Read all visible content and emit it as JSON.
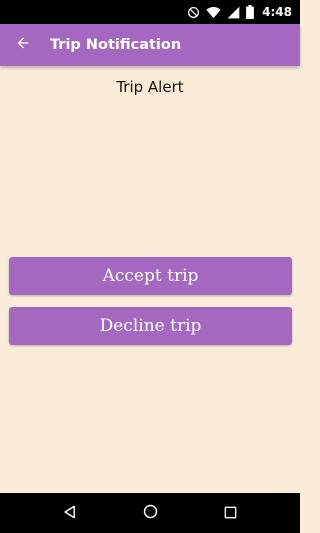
{
  "status_bar": {
    "time": "4:48",
    "icons": [
      "do-not-disturb-icon",
      "wifi-icon",
      "signal-icon",
      "battery-icon"
    ]
  },
  "app_bar": {
    "title": "Trip Notification",
    "back_icon": "arrow-left-icon",
    "color": "#a468c0"
  },
  "content": {
    "title": "Trip Alert"
  },
  "actions": {
    "accept_label": "Accept trip",
    "decline_label": "Decline trip"
  },
  "nav_bar": {
    "icons": [
      "back-triangle-icon",
      "home-circle-icon",
      "recents-square-icon"
    ]
  },
  "colors": {
    "background": "#fbecd9",
    "accent": "#a468c0",
    "text": "#111111"
  }
}
